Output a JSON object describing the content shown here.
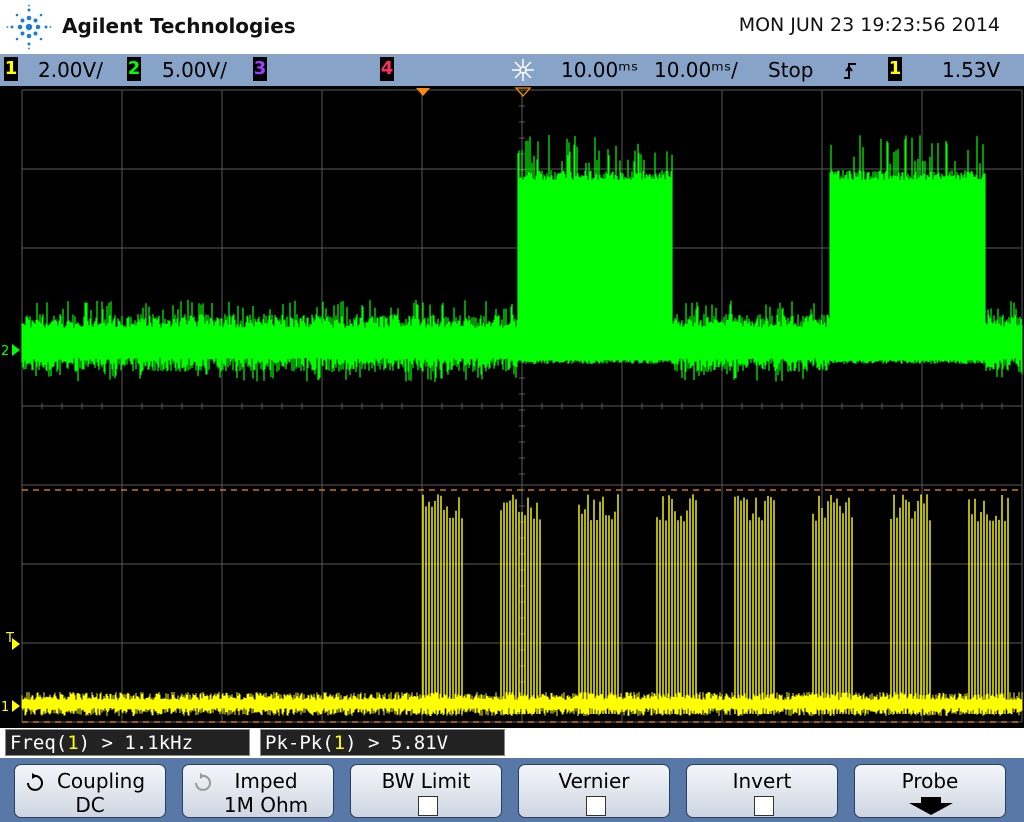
{
  "header": {
    "brand": "Agilent Technologies",
    "datetime": "MON JUN 23 19:23:56 2014"
  },
  "status_bar": {
    "ch1_num": "1",
    "ch1_scale": "2.00V/",
    "ch2_num": "2",
    "ch2_scale": "5.00V/",
    "ch3_num": "3",
    "ch4_num": "4",
    "time_position": "10.00ᵐˢ",
    "time_scale": "10.00ᵐˢ/",
    "run_state": "Stop",
    "trigger_slope_icon": "rising-edge-icon",
    "trigger_source": "1",
    "trigger_level": "1.53V"
  },
  "screen": {
    "ch2_marker": "2",
    "ch1_marker": "1",
    "trigger_marker": "T",
    "colors": {
      "ch1": "#ffff00",
      "ch2": "#00ff00",
      "grid": "#5a5a5a",
      "trigger": "#ff8c00"
    }
  },
  "measurements": {
    "freq_prefix": "Freq(",
    "freq_channel": "1",
    "freq_suffix": ") > 1.1kHz",
    "pkpk_prefix": "Pk-Pk(",
    "pkpk_channel": "1",
    "pkpk_suffix": ") > 5.81V"
  },
  "softkeys": {
    "coupling_label": "Coupling",
    "coupling_value": "DC",
    "imped_label": "Imped",
    "imped_value": "1M Ohm",
    "bw_limit_label": "BW Limit",
    "vernier_label": "Vernier",
    "invert_label": "Invert",
    "probe_label": "Probe"
  }
}
